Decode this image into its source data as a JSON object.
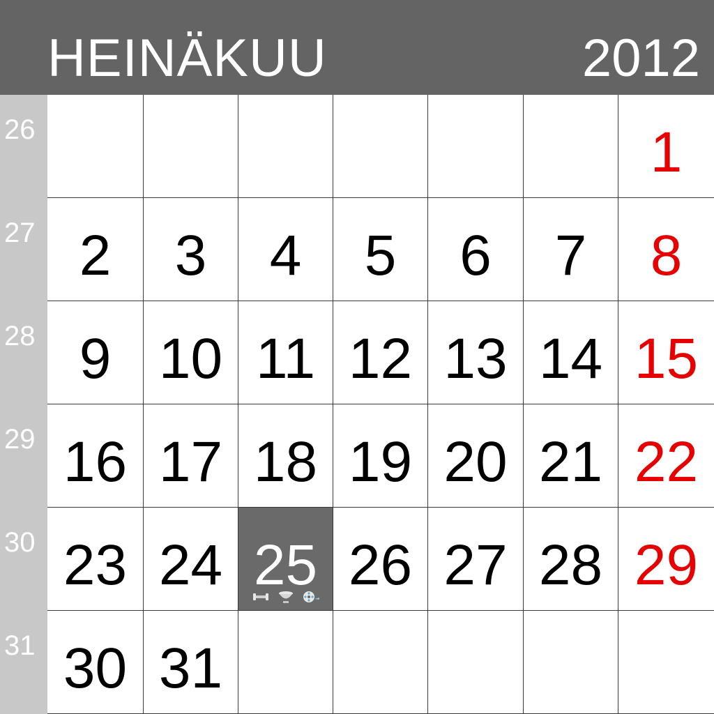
{
  "header": {
    "month": "HEINÄKUU",
    "year": "2012"
  },
  "weeks": [
    {
      "number": "26",
      "days": [
        {
          "label": ""
        },
        {
          "label": ""
        },
        {
          "label": ""
        },
        {
          "label": ""
        },
        {
          "label": ""
        },
        {
          "label": ""
        },
        {
          "label": "1",
          "sunday": true
        }
      ]
    },
    {
      "number": "27",
      "days": [
        {
          "label": "2"
        },
        {
          "label": "3"
        },
        {
          "label": "4"
        },
        {
          "label": "5"
        },
        {
          "label": "6"
        },
        {
          "label": "7"
        },
        {
          "label": "8",
          "sunday": true
        }
      ]
    },
    {
      "number": "28",
      "days": [
        {
          "label": "9"
        },
        {
          "label": "10"
        },
        {
          "label": "11"
        },
        {
          "label": "12"
        },
        {
          "label": "13"
        },
        {
          "label": "14"
        },
        {
          "label": "15",
          "sunday": true
        }
      ]
    },
    {
      "number": "29",
      "days": [
        {
          "label": "16"
        },
        {
          "label": "17"
        },
        {
          "label": "18"
        },
        {
          "label": "19"
        },
        {
          "label": "20"
        },
        {
          "label": "21"
        },
        {
          "label": "22",
          "sunday": true
        }
      ]
    },
    {
      "number": "30",
      "days": [
        {
          "label": "23"
        },
        {
          "label": "24"
        },
        {
          "label": "25",
          "today": true,
          "icons": [
            "dumbbell-icon",
            "bowl-icon",
            "film-reel-icon"
          ]
        },
        {
          "label": "26"
        },
        {
          "label": "27"
        },
        {
          "label": "28"
        },
        {
          "label": "29",
          "sunday": true
        }
      ]
    },
    {
      "number": "31",
      "days": [
        {
          "label": "30"
        },
        {
          "label": "31"
        },
        {
          "label": ""
        },
        {
          "label": ""
        },
        {
          "label": ""
        },
        {
          "label": ""
        },
        {
          "label": "",
          "sunday": true
        }
      ]
    }
  ],
  "colors": {
    "header_bg": "#646464",
    "week_column_bg": "#c8c8c8",
    "sunday_text": "#e60000",
    "today_bg": "#6a6a6a",
    "grid_line": "#3a3a3a"
  }
}
